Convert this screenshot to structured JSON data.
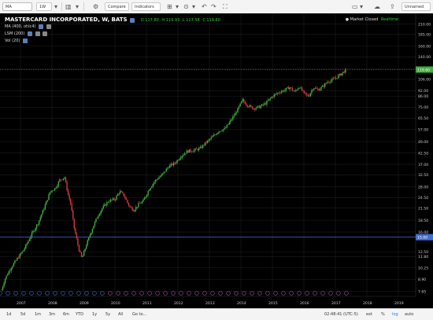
{
  "toolbar": {
    "symbol": "MA",
    "interval": "1W",
    "compare_label": "Compare",
    "indicators_label": "Indicators",
    "user_label": "Unnamed"
  },
  "legend": {
    "title": "MASTERCARD INCORPORATED, W, BATS",
    "ohlc": {
      "o": "O 117.80",
      "h": "H 119.93",
      "l": "L 117.58",
      "c": "C 119.60"
    },
    "indicators": [
      "MA (400, ohlc4)",
      "LSM (200)",
      "Vol (20)"
    ]
  },
  "status": {
    "closed": "Market Closed",
    "realtime": "Realtime"
  },
  "bottom": {
    "ranges": [
      "1d",
      "5d",
      "1m",
      "3m",
      "6m",
      "YTD",
      "1y",
      "5y",
      "All",
      "Go to..."
    ],
    "clock": "02:48:41 (UTC-5)",
    "scale_ext": "ext",
    "scale_pct": "%",
    "scale_log": "log",
    "scale_auto": "auto"
  },
  "chart_data": {
    "type": "candlestick",
    "x_labels": [
      "2007",
      "2008",
      "2009",
      "2010",
      "2011",
      "2012",
      "2013",
      "2014",
      "2015",
      "2016",
      "2017",
      "2018",
      "2019"
    ],
    "y_scale": "log",
    "y_ticks": [
      7.65,
      8.9,
      10.25,
      11.8,
      12.5,
      15.0,
      16.0,
      18.5,
      21.5,
      24.5,
      28.0,
      32.5,
      37.0,
      42.5,
      49.0,
      57.0,
      65.5,
      75.0,
      86.0,
      92.0,
      106.0,
      121.0,
      140.0,
      160.0,
      185.0,
      210.0
    ],
    "y_tick_labels": [
      "7.65",
      "8.90",
      "10.25",
      "11.80",
      "12.50",
      "15.00",
      "16.00",
      "18.50",
      "21.50",
      "24.50",
      "28.00",
      "32.50",
      "37.00",
      "42.50",
      "49.00",
      "57.00",
      "65.50",
      "75.00",
      "86.00",
      "92.00",
      "106.00",
      "121.00",
      "140.00",
      "160.00",
      "185.00",
      "210.00"
    ],
    "ylim": [
      7.2,
      240
    ],
    "last_price": 119.6,
    "last_price_label": "119.60",
    "ref_line": 15.0,
    "ref_line_label": "15.00",
    "price_path": [
      [
        "2006.40",
        7.8
      ],
      [
        "2006.50",
        8.9
      ],
      [
        "2006.70",
        10.3
      ],
      [
        "2006.90",
        11.5
      ],
      [
        "2007.10",
        12.8
      ],
      [
        "2007.35",
        15.5
      ],
      [
        "2007.55",
        17.8
      ],
      [
        "2007.75",
        21.5
      ],
      [
        "2007.95",
        26.5
      ],
      [
        "2008.10",
        27.5
      ],
      [
        "2008.25",
        30.5
      ],
      [
        "2008.40",
        31.5
      ],
      [
        "2008.50",
        26.0
      ],
      [
        "2008.60",
        22.5
      ],
      [
        "2008.70",
        17.0
      ],
      [
        "2008.85",
        13.0
      ],
      [
        "2008.95",
        11.5
      ],
      [
        "2009.10",
        13.8
      ],
      [
        "2009.30",
        17.0
      ],
      [
        "2009.45",
        19.5
      ],
      [
        "2009.60",
        21.5
      ],
      [
        "2009.80",
        23.5
      ],
      [
        "2010.00",
        24.0
      ],
      [
        "2010.15",
        26.5
      ],
      [
        "2010.30",
        25.0
      ],
      [
        "2010.45",
        22.0
      ],
      [
        "2010.60",
        21.0
      ],
      [
        "2010.75",
        22.5
      ],
      [
        "2010.90",
        23.5
      ],
      [
        "2011.10",
        27.5
      ],
      [
        "2011.30",
        30.5
      ],
      [
        "2011.50",
        32.5
      ],
      [
        "2011.70",
        36.0
      ],
      [
        "2011.90",
        37.5
      ],
      [
        "2012.10",
        41.0
      ],
      [
        "2012.30",
        43.5
      ],
      [
        "2012.50",
        44.0
      ],
      [
        "2012.70",
        45.0
      ],
      [
        "2012.90",
        48.5
      ],
      [
        "2013.10",
        52.0
      ],
      [
        "2013.30",
        56.0
      ],
      [
        "2013.50",
        57.5
      ],
      [
        "2013.70",
        64.5
      ],
      [
        "2013.90",
        73.0
      ],
      [
        "2014.05",
        82.0
      ],
      [
        "2014.20",
        77.0
      ],
      [
        "2014.40",
        74.0
      ],
      [
        "2014.60",
        75.5
      ],
      [
        "2014.80",
        79.0
      ],
      [
        "2015.00",
        86.0
      ],
      [
        "2015.20",
        90.0
      ],
      [
        "2015.40",
        93.0
      ],
      [
        "2015.55",
        96.0
      ],
      [
        "2015.70",
        90.5
      ],
      [
        "2015.85",
        97.0
      ],
      [
        "2016.00",
        89.0
      ],
      [
        "2016.15",
        86.0
      ],
      [
        "2016.30",
        96.0
      ],
      [
        "2016.45",
        93.0
      ],
      [
        "2016.60",
        97.0
      ],
      [
        "2016.75",
        103.0
      ],
      [
        "2016.90",
        105.0
      ],
      [
        "2017.05",
        109.0
      ],
      [
        "2017.20",
        114.0
      ],
      [
        "2017.35",
        119.6
      ]
    ]
  }
}
